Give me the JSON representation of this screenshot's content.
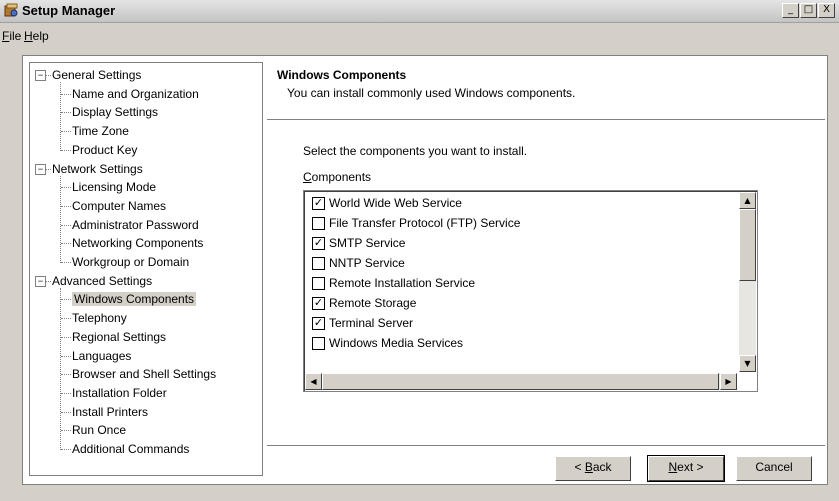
{
  "window": {
    "title": "Setup Manager",
    "controls": [
      "_",
      "□",
      "X"
    ]
  },
  "menu": [
    {
      "label": "File",
      "accel": "F",
      "rest": "ile"
    },
    {
      "label": "Help",
      "accel": "H",
      "rest": "elp"
    }
  ],
  "tree": {
    "groups": [
      {
        "label": "General Settings",
        "expander": "−",
        "children": [
          "Name and Organization",
          "Display Settings",
          "Time Zone",
          "Product Key"
        ]
      },
      {
        "label": "Network Settings",
        "expander": "−",
        "children": [
          "Licensing Mode",
          "Computer Names",
          "Administrator Password",
          "Networking Components",
          "Workgroup or Domain"
        ]
      },
      {
        "label": "Advanced Settings",
        "expander": "−",
        "children": [
          "Windows Components",
          "Telephony",
          "Regional Settings",
          "Languages",
          "Browser and Shell Settings",
          "Installation Folder",
          "Install Printers",
          "Run Once",
          "Additional Commands"
        ]
      }
    ],
    "selected": "Windows Components"
  },
  "content": {
    "title": "Windows Components",
    "subtitle": "You can install commonly used Windows components.",
    "prompt": "Select the components you want to install.",
    "list_label": "Components",
    "list_label_accel": "C",
    "list_label_rest": "omponents",
    "components": [
      {
        "label": "World Wide Web Service",
        "checked": true
      },
      {
        "label": "File Transfer Protocol (FTP) Service",
        "checked": false
      },
      {
        "label": "SMTP Service",
        "checked": true
      },
      {
        "label": "NNTP Service",
        "checked": false
      },
      {
        "label": "Remote Installation Service",
        "checked": false
      },
      {
        "label": "Remote Storage",
        "checked": true
      },
      {
        "label": "Terminal Server",
        "checked": true
      },
      {
        "label": "Windows Media Services",
        "checked": false
      }
    ],
    "check_glyph": "✓"
  },
  "scroll_glyphs": {
    "up": "▲",
    "down": "▼",
    "left": "◀",
    "right": "▶"
  },
  "buttons": {
    "back": {
      "accel": "B",
      "pre": "< ",
      "rest": "ack"
    },
    "next": {
      "accel": "N",
      "rest": "ext >"
    },
    "cancel": "Cancel"
  }
}
